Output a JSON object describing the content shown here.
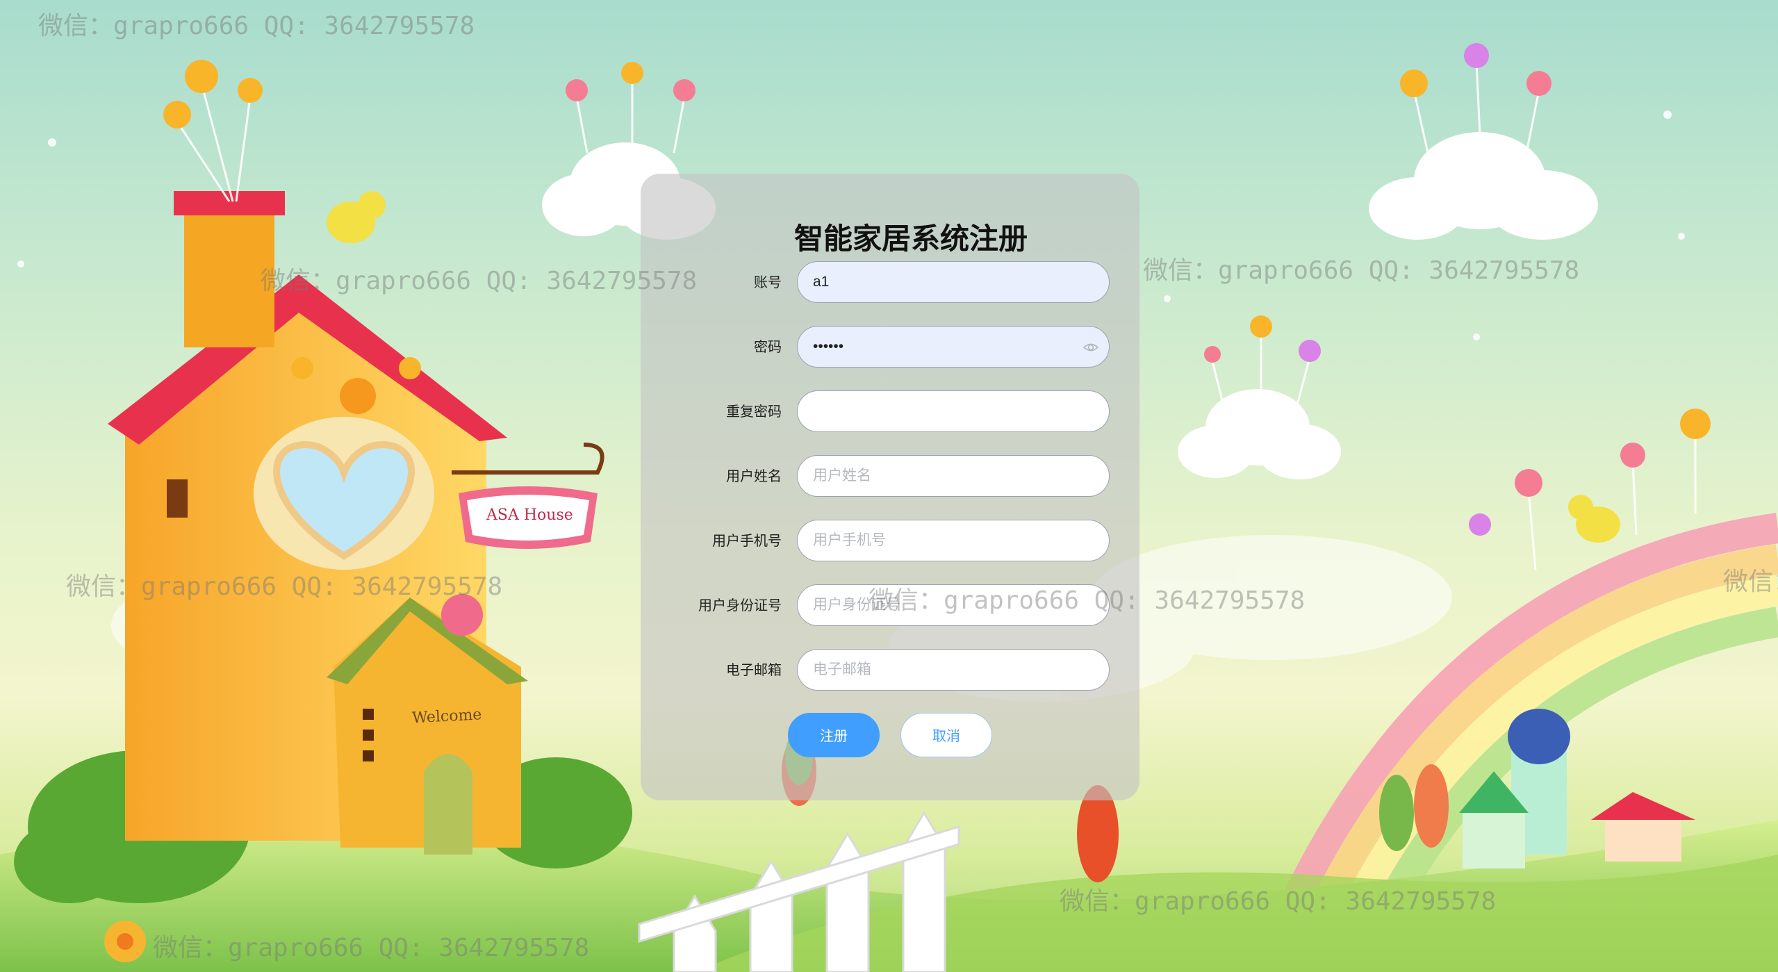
{
  "form": {
    "title": "智能家居系统注册",
    "fields": [
      {
        "label": "账号",
        "value": "a1",
        "placeholder": ""
      },
      {
        "label": "密码",
        "value": "••••••",
        "placeholder": ""
      },
      {
        "label": "重复密码",
        "value": "",
        "placeholder": ""
      },
      {
        "label": "用户姓名",
        "value": "",
        "placeholder": "用户姓名"
      },
      {
        "label": "用户手机号",
        "value": "",
        "placeholder": "用户手机号"
      },
      {
        "label": "用户身份证号",
        "value": "",
        "placeholder": "用户身份证号"
      },
      {
        "label": "电子邮箱",
        "value": "",
        "placeholder": "电子邮箱"
      }
    ],
    "register_label": "注册",
    "cancel_label": "取消"
  },
  "watermark_text": "微信：grapro666 QQ: 3642795578",
  "scene": {
    "sign_text": "ASA House",
    "door_sign_text": "Welcome"
  },
  "colors": {
    "primary": "#409eff",
    "panel_bg": "#c3c3c3"
  }
}
